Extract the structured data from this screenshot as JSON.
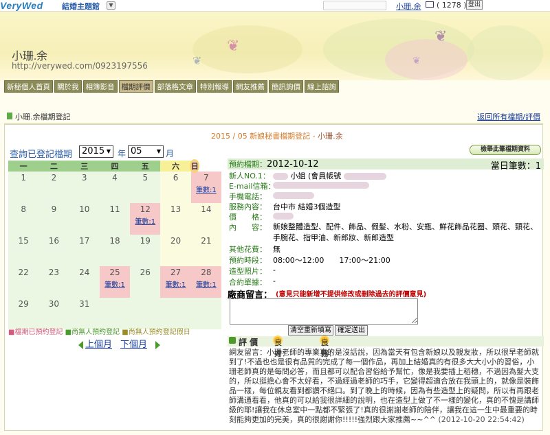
{
  "topbar": {
    "logo": "VeryWed",
    "theme_label": "結婚主題館",
    "user_name": "小珊.余",
    "mail_count": "( 1278 )",
    "logout_label": "登出"
  },
  "banner": {
    "site_name": "小珊.余",
    "site_url": "http://verywed.com/0923197556"
  },
  "nav": [
    "新秘個人首頁",
    "關於我",
    "相簿影音",
    "檔期評價",
    "部落格文章",
    "特別報導",
    "網友推薦",
    "簡訊詢價",
    "線上諮詢"
  ],
  "nav_active": 3,
  "page": {
    "title": "小珊.余檔期登記",
    "back_link": "返回所有檔期/評價"
  },
  "calendar": {
    "month_title_prefix": "2015 / 05 新娘秘書檔期登記 - ",
    "month_title_name": "小珊.余",
    "query_label": "查詢已登記檔期",
    "year_value": "2015",
    "year_label": "年",
    "month_value": "05",
    "month_label": "月",
    "weekdays": [
      "一",
      "二",
      "三",
      "四",
      "五",
      "六",
      "日"
    ],
    "weeks": [
      [
        {
          "d": "1"
        },
        {
          "d": "2"
        },
        {
          "d": "3"
        },
        {
          "d": "4"
        },
        {
          "d": "5"
        },
        {
          "d": "6"
        },
        {
          "d": "7",
          "c": "筆數:1"
        }
      ],
      [
        {
          "d": "8"
        },
        {
          "d": "9"
        },
        {
          "d": "10"
        },
        {
          "d": "11"
        },
        {
          "d": "12",
          "c": "筆數:1"
        },
        {
          "d": "13"
        },
        {
          "d": "14"
        }
      ],
      [
        {
          "d": "15"
        },
        {
          "d": "16"
        },
        {
          "d": "17"
        },
        {
          "d": "18"
        },
        {
          "d": "19"
        },
        {
          "d": "20"
        },
        {
          "d": "21"
        }
      ],
      [
        {
          "d": "22"
        },
        {
          "d": "23"
        },
        {
          "d": "24"
        },
        {
          "d": "25",
          "c": "筆數:1"
        },
        {
          "d": "26"
        },
        {
          "d": "27",
          "c": "筆數:1"
        },
        {
          "d": "28",
          "c": "筆數:1"
        }
      ],
      [
        {
          "d": "29"
        },
        {
          "d": "30"
        },
        {
          "d": "31"
        },
        {
          "d": ""
        },
        {
          "d": ""
        },
        {
          "d": ""
        },
        {
          "d": ""
        }
      ]
    ],
    "legend": {
      "booked": "■檔期已預約登記",
      "free": "■尚無人預約登記",
      "free_holiday": "■尚無人預約登記假日"
    },
    "prev_month": "上個月",
    "next_month": "下個月"
  },
  "detail": {
    "check_button": "檢舉此筆檔期資料",
    "date_label": "預約檔期：",
    "date_value": "2012-10-12",
    "day_count_label": "當日筆數：",
    "day_count_value": "1",
    "bride_label": "新人NO.1：",
    "bride_value": "小姐 (會員帳號",
    "email_label": "E-mail信箱：",
    "phone_label": "手機電話：",
    "service_label": "服務內容：",
    "service_value": "台中市 結婚3個造型",
    "price_label": "價　　格：",
    "content_label": "內　　容：",
    "content_value": "新娘整體造型、配件、飾品、假髮、水粉、安瓶、鮮花飾品花圈、頭花、頸花、手腕花、指甲油、新郎妝、新郎造型",
    "extra_label": "其他花費：",
    "extra_value": "無",
    "time_label": "預約時段：",
    "time_value": "08:00～12:00　　17:00～21:00",
    "photo_label": "造型照片：",
    "photo_value": "-",
    "contract_label": "合約單據：",
    "contract_value": "-",
    "msg_title": "廠商留言：",
    "msg_note": "(意見只能新增不提供修改或刪除過去的評價意見)",
    "reset_button": "清空重新填寫",
    "submit_button": "確定送出",
    "review_title": "評 價",
    "skill_label": "技術：",
    "skill_value": "良好",
    "service_rating_label": "服務：",
    "service_rating_value": "良好",
    "review_text": "網友留言：小珊老師的專業真的是沒話說，因為當天有包含新娘以及親友妝，所以很早老師就到了!不過也也是很有品質的完成了每一個作品，再加上結婚真的有很多大大小小的習俗，小珊老師真的是每問必答，而且都可以配合習俗給予幫忙，像是我要插上稻穗，不過因為髮大支的，所以挺擔心會不太好看，不過經過老師的巧手，它變得超適合放在我頭上的，就像是裝飾品一樣，每位親友看到都讚不絕口。到了晚上的時候，因為有些造型上的疑問，所以有再跟老師溝通看看，他真的可以給我很詳細的說明，也在造型上做了不一樣的變化，真的不愧是講師級的耶!讓我在休息室中一點都不緊張了!真的很謝謝老師的陪伴，讓我在這一生中最重要的時刻能夠更加的完美，真的很謝謝你!!!!!強烈跟大家推薦~~^^",
    "review_time": "(2012-10-20 22:54:42)"
  }
}
